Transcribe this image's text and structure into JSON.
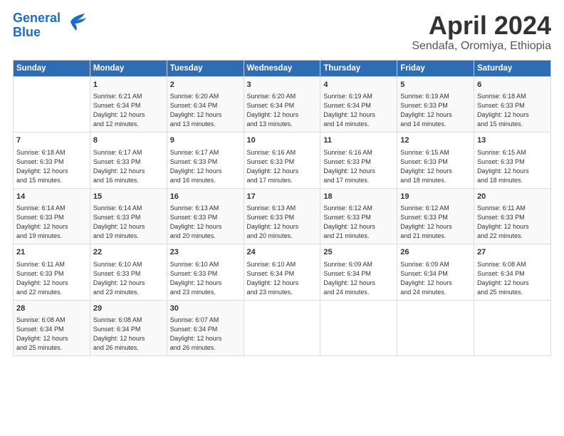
{
  "header": {
    "logo_line1": "General",
    "logo_line2": "Blue",
    "main_title": "April 2024",
    "subtitle": "Sendafa, Oromiya, Ethiopia"
  },
  "calendar": {
    "days_of_week": [
      "Sunday",
      "Monday",
      "Tuesday",
      "Wednesday",
      "Thursday",
      "Friday",
      "Saturday"
    ],
    "weeks": [
      [
        {
          "day": "",
          "info": ""
        },
        {
          "day": "1",
          "info": "Sunrise: 6:21 AM\nSunset: 6:34 PM\nDaylight: 12 hours\nand 12 minutes."
        },
        {
          "day": "2",
          "info": "Sunrise: 6:20 AM\nSunset: 6:34 PM\nDaylight: 12 hours\nand 13 minutes."
        },
        {
          "day": "3",
          "info": "Sunrise: 6:20 AM\nSunset: 6:34 PM\nDaylight: 12 hours\nand 13 minutes."
        },
        {
          "day": "4",
          "info": "Sunrise: 6:19 AM\nSunset: 6:34 PM\nDaylight: 12 hours\nand 14 minutes."
        },
        {
          "day": "5",
          "info": "Sunrise: 6:19 AM\nSunset: 6:33 PM\nDaylight: 12 hours\nand 14 minutes."
        },
        {
          "day": "6",
          "info": "Sunrise: 6:18 AM\nSunset: 6:33 PM\nDaylight: 12 hours\nand 15 minutes."
        }
      ],
      [
        {
          "day": "7",
          "info": "Sunrise: 6:18 AM\nSunset: 6:33 PM\nDaylight: 12 hours\nand 15 minutes."
        },
        {
          "day": "8",
          "info": "Sunrise: 6:17 AM\nSunset: 6:33 PM\nDaylight: 12 hours\nand 16 minutes."
        },
        {
          "day": "9",
          "info": "Sunrise: 6:17 AM\nSunset: 6:33 PM\nDaylight: 12 hours\nand 16 minutes."
        },
        {
          "day": "10",
          "info": "Sunrise: 6:16 AM\nSunset: 6:33 PM\nDaylight: 12 hours\nand 17 minutes."
        },
        {
          "day": "11",
          "info": "Sunrise: 6:16 AM\nSunset: 6:33 PM\nDaylight: 12 hours\nand 17 minutes."
        },
        {
          "day": "12",
          "info": "Sunrise: 6:15 AM\nSunset: 6:33 PM\nDaylight: 12 hours\nand 18 minutes."
        },
        {
          "day": "13",
          "info": "Sunrise: 6:15 AM\nSunset: 6:33 PM\nDaylight: 12 hours\nand 18 minutes."
        }
      ],
      [
        {
          "day": "14",
          "info": "Sunrise: 6:14 AM\nSunset: 6:33 PM\nDaylight: 12 hours\nand 19 minutes."
        },
        {
          "day": "15",
          "info": "Sunrise: 6:14 AM\nSunset: 6:33 PM\nDaylight: 12 hours\nand 19 minutes."
        },
        {
          "day": "16",
          "info": "Sunrise: 6:13 AM\nSunset: 6:33 PM\nDaylight: 12 hours\nand 20 minutes."
        },
        {
          "day": "17",
          "info": "Sunrise: 6:13 AM\nSunset: 6:33 PM\nDaylight: 12 hours\nand 20 minutes."
        },
        {
          "day": "18",
          "info": "Sunrise: 6:12 AM\nSunset: 6:33 PM\nDaylight: 12 hours\nand 21 minutes."
        },
        {
          "day": "19",
          "info": "Sunrise: 6:12 AM\nSunset: 6:33 PM\nDaylight: 12 hours\nand 21 minutes."
        },
        {
          "day": "20",
          "info": "Sunrise: 6:11 AM\nSunset: 6:33 PM\nDaylight: 12 hours\nand 22 minutes."
        }
      ],
      [
        {
          "day": "21",
          "info": "Sunrise: 6:11 AM\nSunset: 6:33 PM\nDaylight: 12 hours\nand 22 minutes."
        },
        {
          "day": "22",
          "info": "Sunrise: 6:10 AM\nSunset: 6:33 PM\nDaylight: 12 hours\nand 23 minutes."
        },
        {
          "day": "23",
          "info": "Sunrise: 6:10 AM\nSunset: 6:33 PM\nDaylight: 12 hours\nand 23 minutes."
        },
        {
          "day": "24",
          "info": "Sunrise: 6:10 AM\nSunset: 6:34 PM\nDaylight: 12 hours\nand 23 minutes."
        },
        {
          "day": "25",
          "info": "Sunrise: 6:09 AM\nSunset: 6:34 PM\nDaylight: 12 hours\nand 24 minutes."
        },
        {
          "day": "26",
          "info": "Sunrise: 6:09 AM\nSunset: 6:34 PM\nDaylight: 12 hours\nand 24 minutes."
        },
        {
          "day": "27",
          "info": "Sunrise: 6:08 AM\nSunset: 6:34 PM\nDaylight: 12 hours\nand 25 minutes."
        }
      ],
      [
        {
          "day": "28",
          "info": "Sunrise: 6:08 AM\nSunset: 6:34 PM\nDaylight: 12 hours\nand 25 minutes."
        },
        {
          "day": "29",
          "info": "Sunrise: 6:08 AM\nSunset: 6:34 PM\nDaylight: 12 hours\nand 26 minutes."
        },
        {
          "day": "30",
          "info": "Sunrise: 6:07 AM\nSunset: 6:34 PM\nDaylight: 12 hours\nand 26 minutes."
        },
        {
          "day": "",
          "info": ""
        },
        {
          "day": "",
          "info": ""
        },
        {
          "day": "",
          "info": ""
        },
        {
          "day": "",
          "info": ""
        }
      ]
    ]
  }
}
